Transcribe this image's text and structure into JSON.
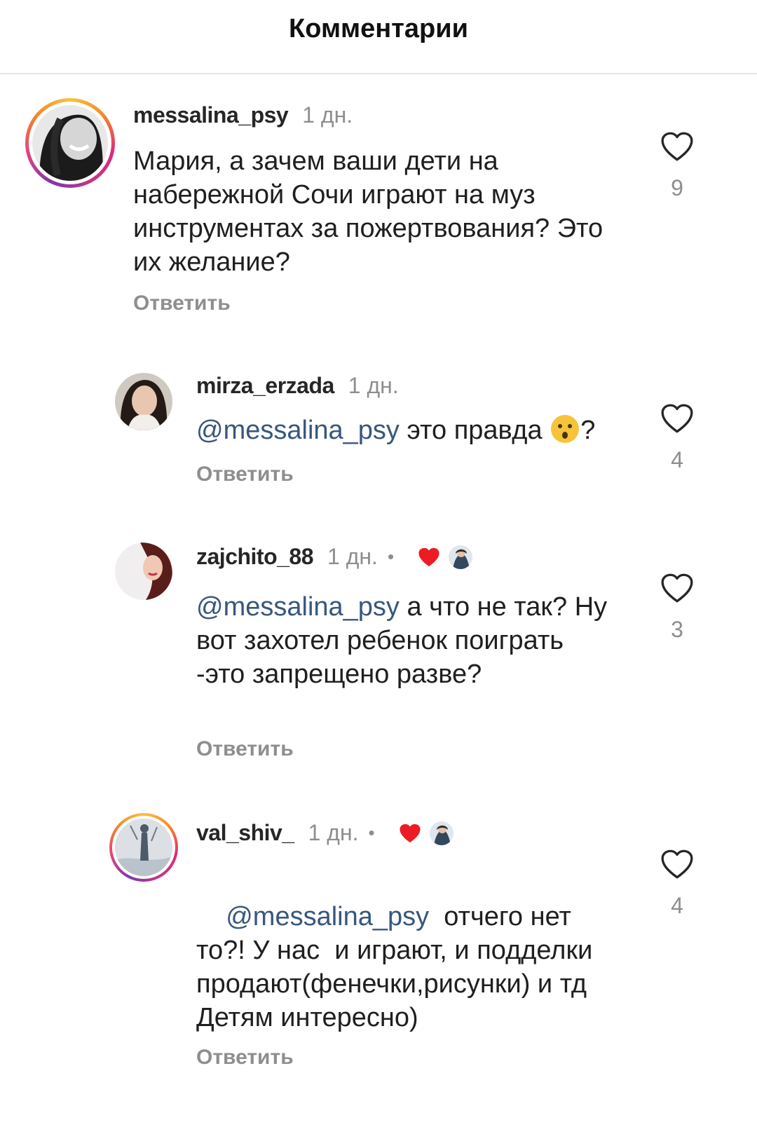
{
  "header": {
    "title": "Комментарии"
  },
  "colors": {
    "mention": "#37577d",
    "muted": "#8e8e8e",
    "like_red": "#ed1c24"
  },
  "comments": [
    {
      "username": "messalina_psy",
      "time": "1 дн.",
      "text": "Мария, а зачем ваши дети на набережной Сочи играют на муз инструментах за пожертвования? Это их желание?",
      "reply_label": "Ответить",
      "likes": "9",
      "story_ring": true
    },
    {
      "username": "mirza_erzada",
      "time": "1 дн.",
      "mention": "@messalina_psy",
      "text": " это правда ",
      "text_after_emoji": "?",
      "emoji": "hushed-face-emoji",
      "reply_label": "Ответить",
      "likes": "4",
      "story_ring": false
    },
    {
      "username": "zajchito_88",
      "time": "1 дн.",
      "separator": "•",
      "liked_by_author": true,
      "mention": "@messalina_psy",
      "text": " а что не так? Ну вот захотел ребенок поиграть -это запрещено разве?",
      "reply_label": "Ответить",
      "likes": "3",
      "story_ring": false
    },
    {
      "username": "val_shiv_",
      "time": "1 дн.",
      "separator": "•",
      "liked_by_author": true,
      "mention": "@messalina_psy",
      "text": "  отчего нет то?! У нас  и играют, и подделки продают(фенечки,рисунки) и тд Детям интересно)",
      "reply_label": "Ответить",
      "likes": "4",
      "story_ring": true
    }
  ]
}
